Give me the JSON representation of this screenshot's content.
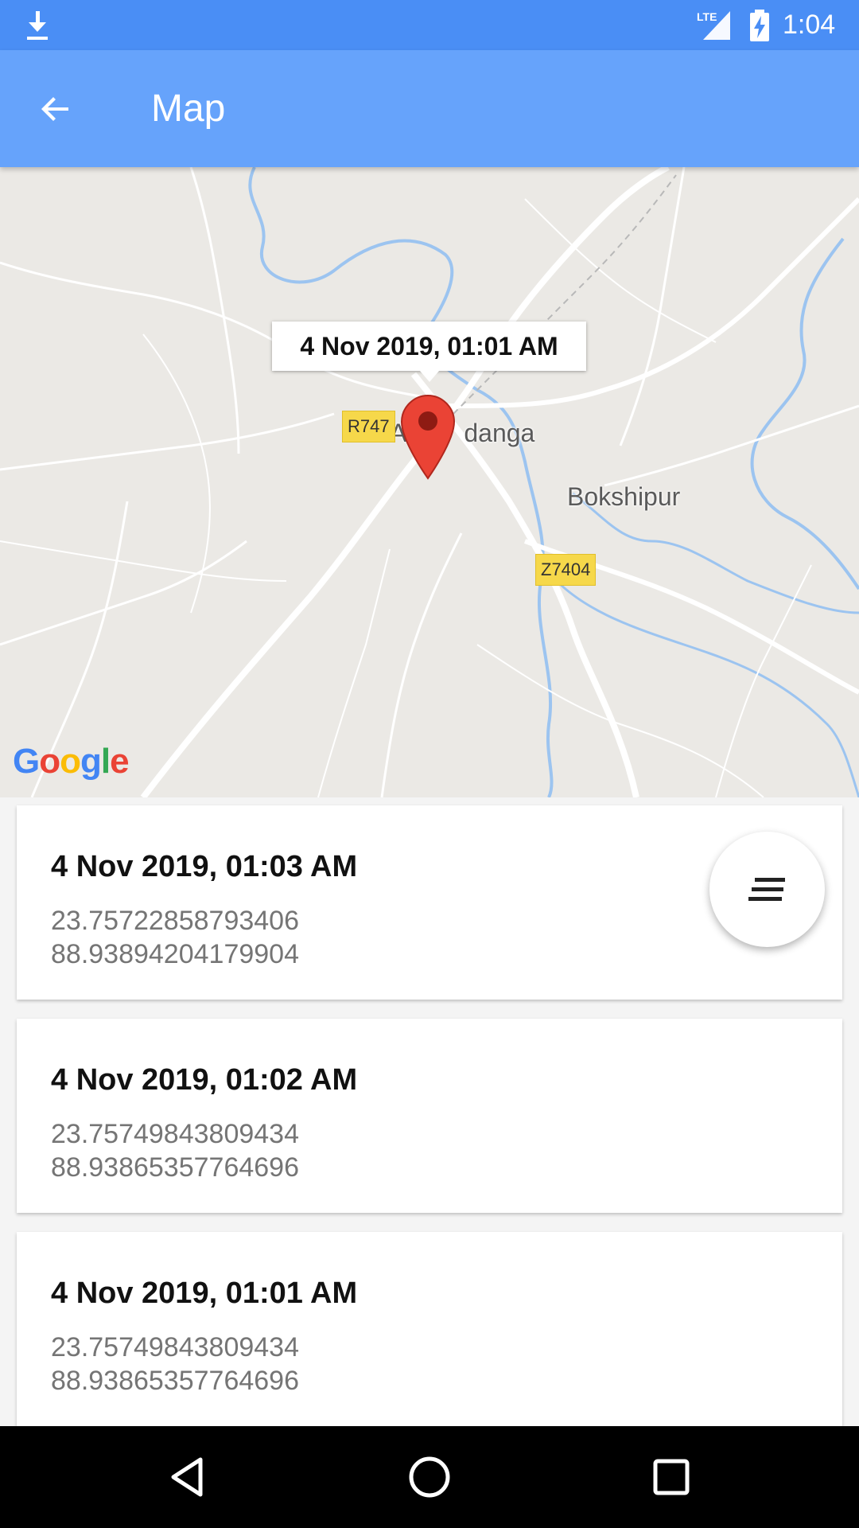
{
  "status_bar": {
    "time": "1:04",
    "network_label": "LTE",
    "icons": [
      "download-icon",
      "lte-signal-icon",
      "battery-charging-icon"
    ]
  },
  "app_bar": {
    "title": "Map",
    "back_icon": "arrow-left-icon",
    "color": "#66a3fb"
  },
  "map": {
    "info_window": "4 Nov 2019, 01:01 AM",
    "place_labels": {
      "town": "A",
      "town_suffix": "danga",
      "village": "Bokshipur"
    },
    "roads": {
      "r1": "R747",
      "r2": "Z7404"
    },
    "attribution": [
      "G",
      "o",
      "o",
      "g",
      "l",
      "e"
    ],
    "marker_color": "#ea4335"
  },
  "locations": [
    {
      "time": "4 Nov 2019, 01:03 AM",
      "lat": "23.75722858793406",
      "lng": "88.93894204179904"
    },
    {
      "time": "4 Nov 2019, 01:02 AM",
      "lat": "23.75749843809434",
      "lng": "88.93865357764696"
    },
    {
      "time": "4 Nov 2019, 01:01 AM",
      "lat": "23.75749843809434",
      "lng": "88.93865357764696"
    }
  ],
  "fab": {
    "icon": "sort-lines-icon"
  },
  "nav_bar": {
    "buttons": [
      "back-triangle-icon",
      "home-circle-icon",
      "recents-square-icon"
    ]
  }
}
